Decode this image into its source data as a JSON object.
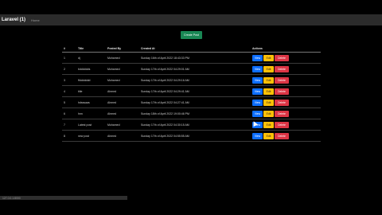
{
  "navbar": {
    "brand": "Laravel (1)",
    "link": "Home"
  },
  "create_button": "Create Post",
  "table": {
    "headers": [
      "#",
      "Title",
      "Posted By",
      "Created At",
      "Actions"
    ],
    "rows": [
      {
        "num": "1",
        "title": "dj",
        "by": "Mohamed",
        "created": "Sunday 16th of April 2022 18:43:33 PM"
      },
      {
        "num": "2",
        "title": "bdddddds",
        "by": "Mohamed",
        "created": "Sunday 17th of April 2022 04:29:01 AM"
      },
      {
        "num": "3",
        "title": "ffddddddd",
        "by": "Mohamed",
        "created": "Sunday 17th of April 2022 04:29:16 AM"
      },
      {
        "num": "4",
        "title": "title",
        "by": "Ahmed",
        "created": "Sunday 17th of April 2022 04:29:41 AM"
      },
      {
        "num": "5",
        "title": "hdsssaas",
        "by": "Ahmed",
        "created": "Sunday 17th of April 2022 04:27:41 AM"
      },
      {
        "num": "6",
        "title": "hnn",
        "by": "Ahmed",
        "created": "Sunday 18th of April 2022 19:00:46 PM"
      },
      {
        "num": "7",
        "title": "Latest post",
        "by": "Mohamed",
        "created": "Sunday 17th of April 2022 04:30:15 AM"
      },
      {
        "num": "8",
        "title": "new post",
        "by": "Ahmed",
        "created": "Sunday 17th of April 2022 04:55:55 AM"
      }
    ],
    "view_label": "View",
    "edit_label": "Edit",
    "delete_label": "Delete"
  },
  "statusbar": {
    "text": "127.0.0.1:8000"
  },
  "colors": {
    "view": "#0d6efd",
    "edit": "#ffc107",
    "delete": "#dc3545",
    "create": "#198754"
  }
}
